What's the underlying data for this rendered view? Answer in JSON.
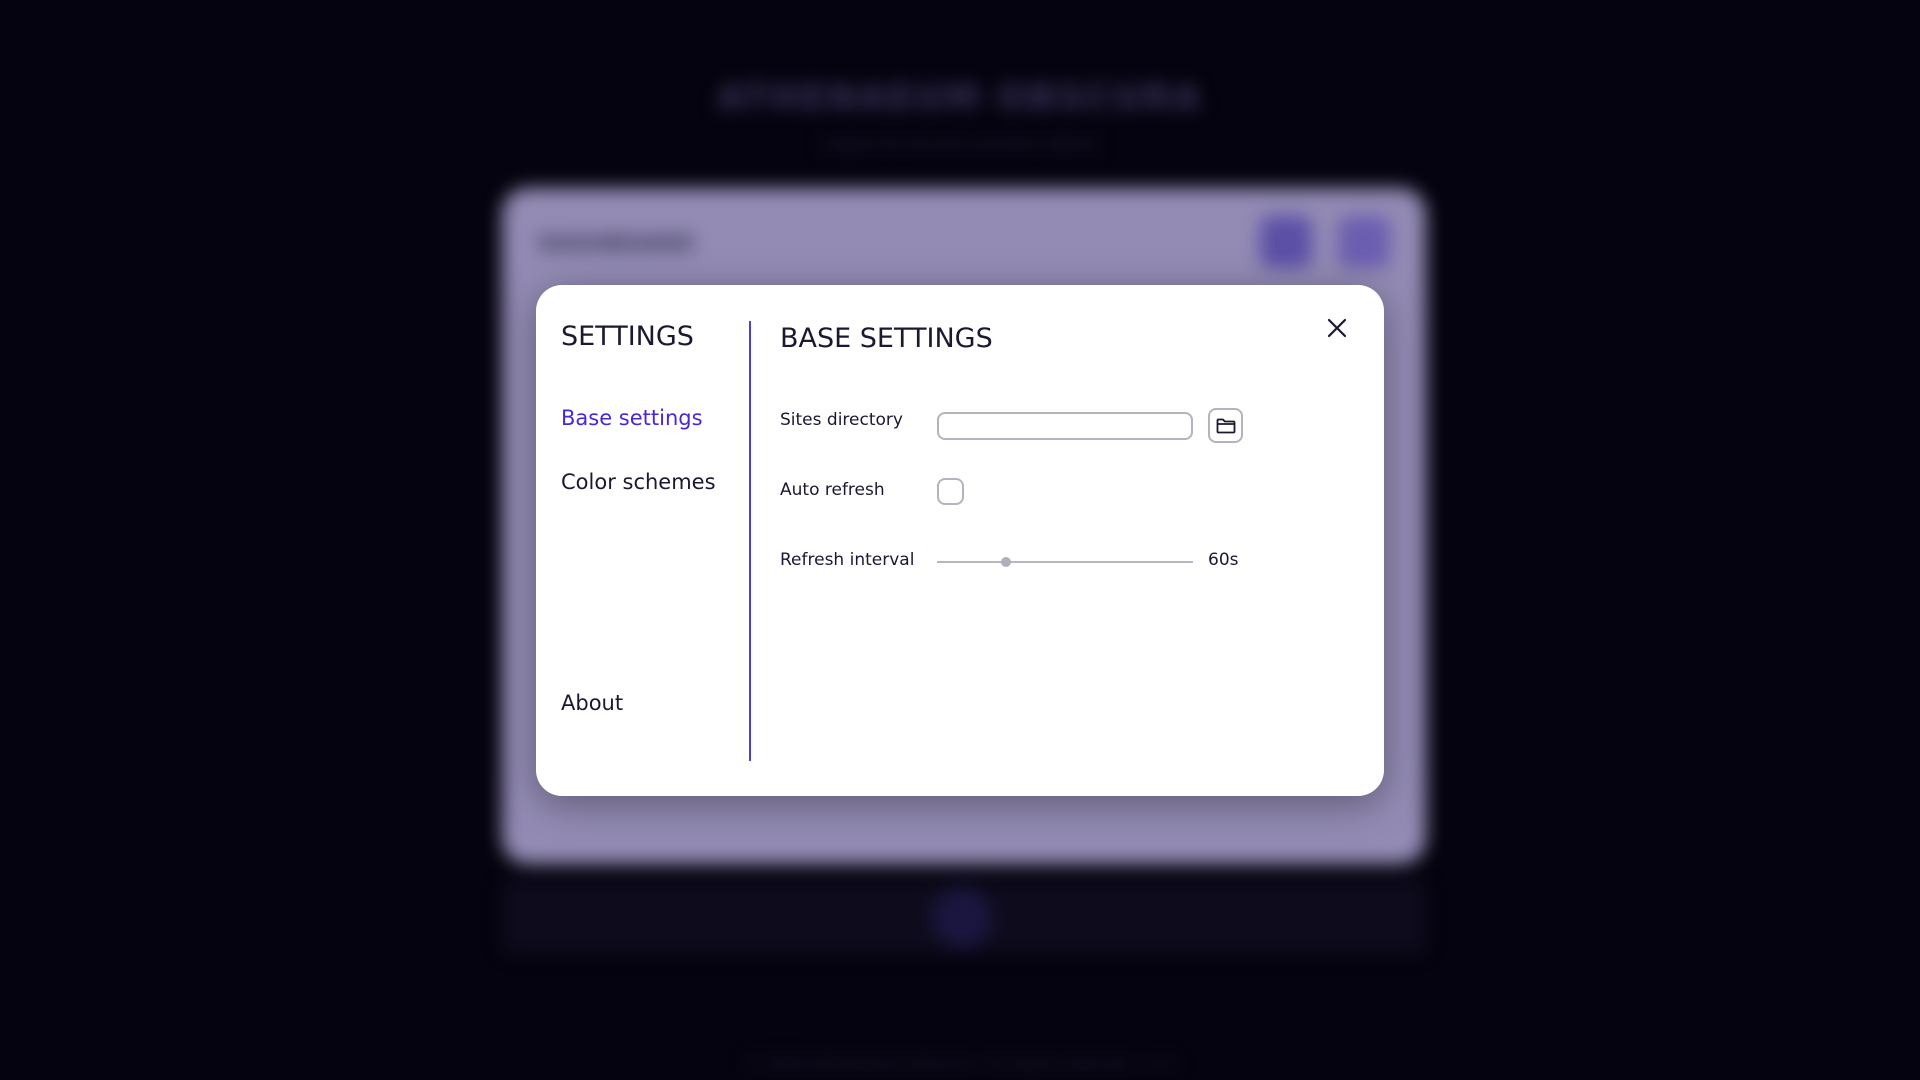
{
  "background": {
    "app_title": "ATHENAEUM OBSCURA",
    "app_subtitle": "a place for all your ancient codices",
    "card_title": "DASHBOARD",
    "footer_text": "© 2024 Athenaeum Obscura. All rights reserved. v1.0"
  },
  "modal": {
    "sidebar": {
      "title": "SETTINGS",
      "items": [
        {
          "label": "Base settings",
          "active": true
        },
        {
          "label": "Color schemes",
          "active": false
        },
        {
          "label": "About",
          "active": false
        }
      ]
    },
    "content": {
      "title": "BASE SETTINGS",
      "sites_directory": {
        "label": "Sites directory",
        "value": ""
      },
      "auto_refresh": {
        "label": "Auto refresh",
        "checked": false
      },
      "refresh_interval": {
        "label": "Refresh interval",
        "value_label": "60s",
        "fraction": 0.27
      }
    }
  },
  "colors": {
    "accent": "#4a26d8",
    "divider": "#4a3fd6",
    "text": "#1b1830",
    "overlay": "#05030f"
  },
  "icons": {
    "close": "close-icon",
    "folder": "folder-icon"
  }
}
